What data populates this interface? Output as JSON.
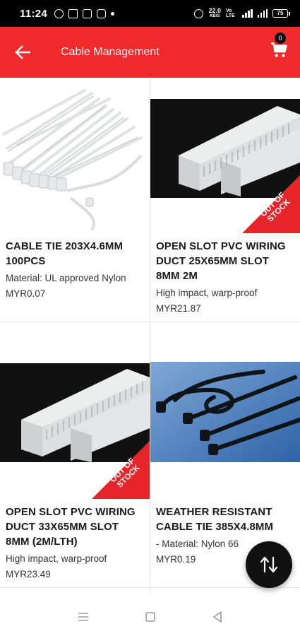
{
  "status_bar": {
    "time": "11:24",
    "net_speed_value": "22.0",
    "net_speed_unit": "KB/S",
    "network_type": "Vo LTE",
    "battery": "75"
  },
  "app_bar": {
    "title": "Cable Management",
    "cart_count": "0",
    "background_color": "#f12a2e"
  },
  "products": [
    {
      "name": "CABLE TIE 203X4.6MM 100PCS",
      "description": "Material: UL approved Nylon",
      "price": "MYR0.07",
      "out_of_stock": false
    },
    {
      "name": "OPEN SLOT PVC WIRING DUCT 25X65MM SLOT 8MM 2M",
      "description": "High impact, warp-proof",
      "price": "MYR21.87",
      "out_of_stock": true
    },
    {
      "name": "OPEN SLOT PVC WIRING DUCT 33X65MM SLOT 8MM (2M/LTH)",
      "description": "High impact, warp-proof",
      "price": "MYR23.49",
      "out_of_stock": true
    },
    {
      "name": "WEATHER RESISTANT CABLE TIE 385X4.8MM",
      "description": "- Material: Nylon 66",
      "price": "MYR0.19",
      "out_of_stock": false
    }
  ],
  "out_of_stock_badge": {
    "line1": "OUT OF",
    "line2": "STOCK",
    "color": "#e8242b"
  },
  "icons": {
    "back": "arrow-left-icon",
    "cart": "shopping-cart-icon",
    "sort": "sort-icon",
    "nav_recents": "recents-icon",
    "nav_home": "home-icon",
    "nav_back": "nav-back-icon"
  }
}
